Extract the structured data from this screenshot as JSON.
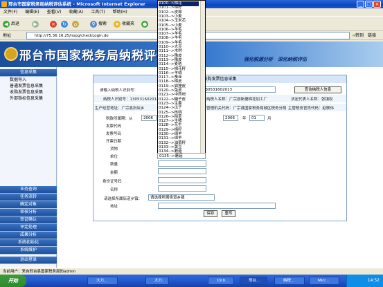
{
  "window": {
    "title": "邢台市国家税务局纳税评估系统 - Microsoft Internet Explorer",
    "btn_min": "_",
    "btn_max": "□",
    "btn_close": "×"
  },
  "menu": [
    "文件(F)",
    "编辑(E)",
    "查看(V)",
    "收藏(A)",
    "工具(T)",
    "帮助(H)"
  ],
  "toolbar": {
    "back": "后退",
    "search": "搜索",
    "favorites": "收藏夹"
  },
  "address": {
    "label": "地址",
    "url": "http://75.36.16.25/nspg/checkLogin.do",
    "go": "转到",
    "links": "链接"
  },
  "banner": {
    "title": "邢台市国家税务局纳税评估系统",
    "slogan": "强化税源分析　深化纳税评估"
  },
  "leftnav": {
    "top_header": "信息采集",
    "top_items": [
      "数据导入",
      "普通发票信息采集",
      "收购发票信息采集",
      "外部指标信息采集"
    ],
    "bottom_items": [
      "业务查询",
      "任务流转",
      "确定对象",
      "审核分析",
      "审证确认",
      "评定处理",
      "成果分析",
      "系统初始化",
      "系统维护",
      "退出登录"
    ]
  },
  "form": {
    "header": "收购发票信息采集",
    "taxpayer_id_label": "请输入纳税人识别号：",
    "taxpayer_id_value": "130531602013",
    "query_button": "查询纳税人信息",
    "taxpayer_id_row": "纳税人识别号：130531602013",
    "taxpayer_name_row": "纳税人名称：广宗县新捷棉花加工厂",
    "legal_rep_row": "法定代表人名称：张镇权",
    "address_row": "生产经营地址：广宗县旧店乡",
    "tax_authority_row": "管理机关代码：广宗县国家税务局城区税务分局",
    "officer_row": "主管税务官员代码：赵联伟",
    "period_label": "税款所属期：从",
    "period_from_year": "2006",
    "period_to_year": "2006",
    "period_year_unit": "年",
    "period_to_month": "01",
    "period_month_unit": "月",
    "fields": [
      "发票代码",
      "发票号码",
      "开票日期",
      "货物",
      "单位",
      "数量",
      "金额",
      "身份证号码",
      "名称"
    ],
    "street_label": "请选择所属街道乡镇：",
    "street_select": "请选择所属街道乡镇",
    "address_label": "地址",
    "save_button": "保存",
    "reset_button": "重写"
  },
  "dropdown": {
    "items": [
      "0100-->棉花",
      "0101-->棉籽",
      "0102-->皮棉",
      "0103-->小麦",
      "0104-->玉米芯",
      "0105-->小麦",
      "0106-->羊毛",
      "0107-->羊毛",
      "0108-->羊毛",
      "0109-->羊毛",
      "0110-->大豆",
      "0111-->木材",
      "0112-->豫皮",
      "0113-->豫皮",
      "0114-->麦秸",
      "0115-->棉花籽",
      "0116-->羊绒",
      "0117-->蚕丝",
      "0118-->棉皮",
      "0119-->狐狸皮",
      "0120-->兔皮",
      "0121-->中药材",
      "0122-->糖子皮",
      "0123-->生姜",
      "0124-->瓜子",
      "0125-->核桃",
      "0126-->稻草",
      "0127-->生猪",
      "0128-->花生",
      "0129-->棉籽",
      "0130-->绵羊",
      "0131-->绵羊",
      "0132-->油菜籽",
      "0133-->黄豆",
      "0134-->蘑菇"
    ],
    "selected_index": 0,
    "field_value": "0135-->蘑菇"
  },
  "status": "当前用户：来自邢台县国家税务局的admin",
  "taskbar": {
    "start": "开始",
    "tasks": [
      "大力...",
      "大力...",
      "19.b...",
      "邢台...",
      "纳税...",
      "Micr..."
    ],
    "time": "14:52"
  },
  "colors": {
    "banner_dark": "#1b4e9b",
    "nav_header": "#3b73c2",
    "selection": "#0a246a"
  }
}
